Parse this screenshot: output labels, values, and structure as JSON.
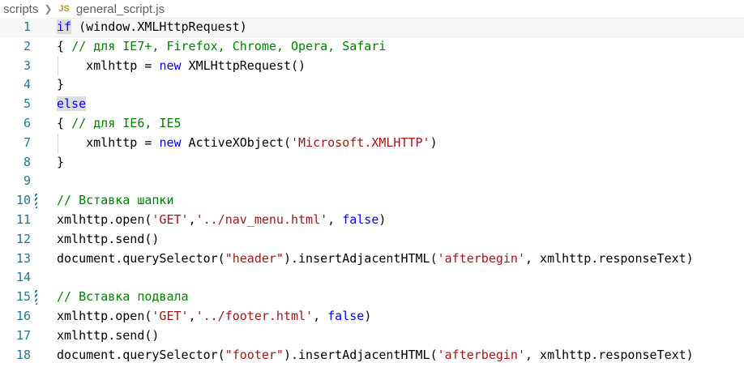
{
  "breadcrumb": {
    "folder": "scripts",
    "file_icon": "JS",
    "file_name": "general_script.js"
  },
  "editor": {
    "lines": [
      {
        "num": "1",
        "tokens": [
          {
            "t": "if",
            "c": "kw-hl"
          },
          {
            "t": " (window.XMLHttpRequest)",
            "c": ""
          }
        ]
      },
      {
        "num": "2",
        "tokens": [
          {
            "t": "{ ",
            "c": ""
          },
          {
            "t": "// для IE7+, Firefox, Chrome, Opera, Safari",
            "c": "cmt"
          }
        ]
      },
      {
        "num": "3",
        "tokens": [
          {
            "t": "    xmlhttp = ",
            "c": ""
          },
          {
            "t": "new",
            "c": "kw"
          },
          {
            "t": " XMLHttpRequest()",
            "c": ""
          }
        ]
      },
      {
        "num": "4",
        "tokens": [
          {
            "t": "}",
            "c": ""
          }
        ]
      },
      {
        "num": "5",
        "tokens": [
          {
            "t": "else",
            "c": "kw-hl"
          }
        ]
      },
      {
        "num": "6",
        "tokens": [
          {
            "t": "{ ",
            "c": ""
          },
          {
            "t": "// для IE6, IE5",
            "c": "cmt"
          }
        ]
      },
      {
        "num": "7",
        "tokens": [
          {
            "t": "    xmlhttp = ",
            "c": ""
          },
          {
            "t": "new",
            "c": "kw"
          },
          {
            "t": " ActiveXObject(",
            "c": ""
          },
          {
            "t": "'Microsoft.XMLHTTP'",
            "c": "str"
          },
          {
            "t": ")",
            "c": ""
          }
        ]
      },
      {
        "num": "8",
        "tokens": [
          {
            "t": "}",
            "c": ""
          }
        ]
      },
      {
        "num": "9",
        "tokens": []
      },
      {
        "num": "10",
        "tokens": [
          {
            "t": "// Вставка шапки",
            "c": "cmt"
          }
        ]
      },
      {
        "num": "11",
        "tokens": [
          {
            "t": "xmlhttp.open(",
            "c": ""
          },
          {
            "t": "'GET'",
            "c": "str"
          },
          {
            "t": ",",
            "c": ""
          },
          {
            "t": "'../nav_menu.html'",
            "c": "str"
          },
          {
            "t": ", ",
            "c": ""
          },
          {
            "t": "false",
            "c": "kw"
          },
          {
            "t": ")",
            "c": ""
          }
        ]
      },
      {
        "num": "12",
        "tokens": [
          {
            "t": "xmlhttp.send()",
            "c": ""
          }
        ]
      },
      {
        "num": "13",
        "tokens": [
          {
            "t": "document.querySelector(",
            "c": ""
          },
          {
            "t": "\"header\"",
            "c": "str"
          },
          {
            "t": ").insertAdjacentHTML(",
            "c": ""
          },
          {
            "t": "'afterbegin'",
            "c": "str"
          },
          {
            "t": ", xmlhttp.responseText)",
            "c": ""
          }
        ]
      },
      {
        "num": "14",
        "tokens": []
      },
      {
        "num": "15",
        "tokens": [
          {
            "t": "// Вставка подвала",
            "c": "cmt"
          }
        ]
      },
      {
        "num": "16",
        "tokens": [
          {
            "t": "xmlhttp.open(",
            "c": ""
          },
          {
            "t": "'GET'",
            "c": "str"
          },
          {
            "t": ",",
            "c": ""
          },
          {
            "t": "'../footer.html'",
            "c": "str"
          },
          {
            "t": ", ",
            "c": ""
          },
          {
            "t": "false",
            "c": "kw"
          },
          {
            "t": ")",
            "c": ""
          }
        ]
      },
      {
        "num": "17",
        "tokens": [
          {
            "t": "xmlhttp.send()",
            "c": ""
          }
        ]
      },
      {
        "num": "18",
        "tokens": [
          {
            "t": "document.querySelector(",
            "c": ""
          },
          {
            "t": "\"footer\"",
            "c": "str"
          },
          {
            "t": ").insertAdjacentHTML(",
            "c": ""
          },
          {
            "t": "'afterbegin'",
            "c": "str"
          },
          {
            "t": ", xmlhttp.responseText)",
            "c": ""
          }
        ]
      }
    ],
    "active_line": "1",
    "modified_lines": [
      "10",
      "15"
    ],
    "indented_lines": [
      "3",
      "7"
    ]
  },
  "colors": {
    "keyword": "#0000ff",
    "string": "#a31515",
    "comment": "#008000",
    "line_number": "#237893"
  }
}
